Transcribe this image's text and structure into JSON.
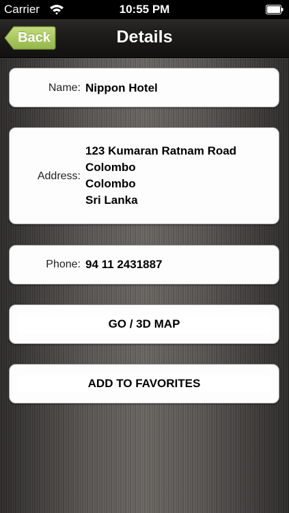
{
  "status_bar": {
    "carrier": "Carrier",
    "time": "10:55 PM"
  },
  "nav": {
    "back_label": "Back",
    "title": "Details",
    "back_color": "#a6c85a"
  },
  "details": {
    "name_label": "Name:",
    "name_value": "Nippon Hotel",
    "address_label": "Address:",
    "address_lines": [
      "123 Kumaran Ratnam Road",
      "Colombo",
      "Colombo",
      "Sri Lanka"
    ],
    "phone_label": "Phone:",
    "phone_value": "94 11 2431887"
  },
  "actions": {
    "map_label": "GO / 3D MAP",
    "favorites_label": "ADD TO FAVORITES"
  }
}
